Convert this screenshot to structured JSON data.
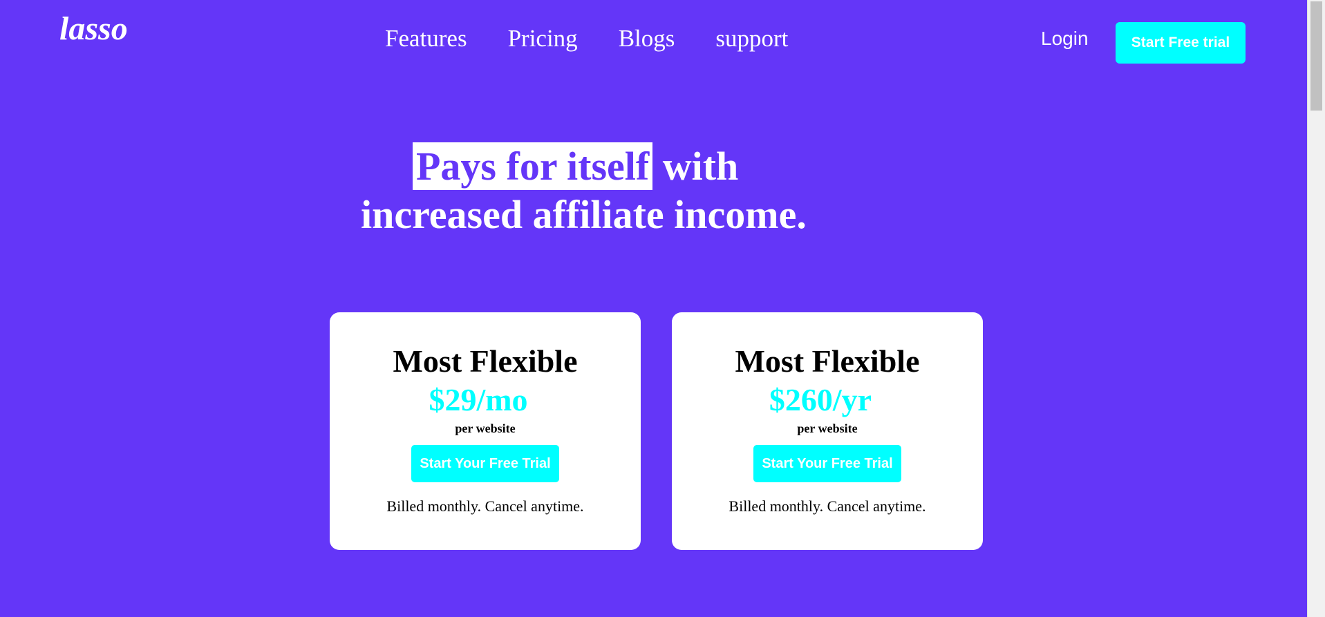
{
  "brand": {
    "logo_text": "lasso"
  },
  "nav": {
    "items": [
      {
        "label": "Features"
      },
      {
        "label": "Pricing"
      },
      {
        "label": "Blogs"
      },
      {
        "label": "support"
      }
    ]
  },
  "header": {
    "login_label": "Login",
    "trial_label": "Start Free trial"
  },
  "hero": {
    "highlight": "Pays for itself",
    "line1_rest": " with",
    "line2": "increased affiliate income."
  },
  "plans": [
    {
      "title": "Most Flexible",
      "price": "$29/mo",
      "per": "per website",
      "button": "Start Your Free Trial",
      "note": "Billed monthly. Cancel anytime."
    },
    {
      "title": "Most Flexible",
      "price": "$260/yr",
      "per": "per website",
      "button": "Start Your Free Trial",
      "note": "Billed monthly. Cancel anytime."
    }
  ],
  "colors": {
    "background": "#6436f8",
    "accent": "#00ffff",
    "card": "#ffffff",
    "text_dark": "#000000"
  }
}
